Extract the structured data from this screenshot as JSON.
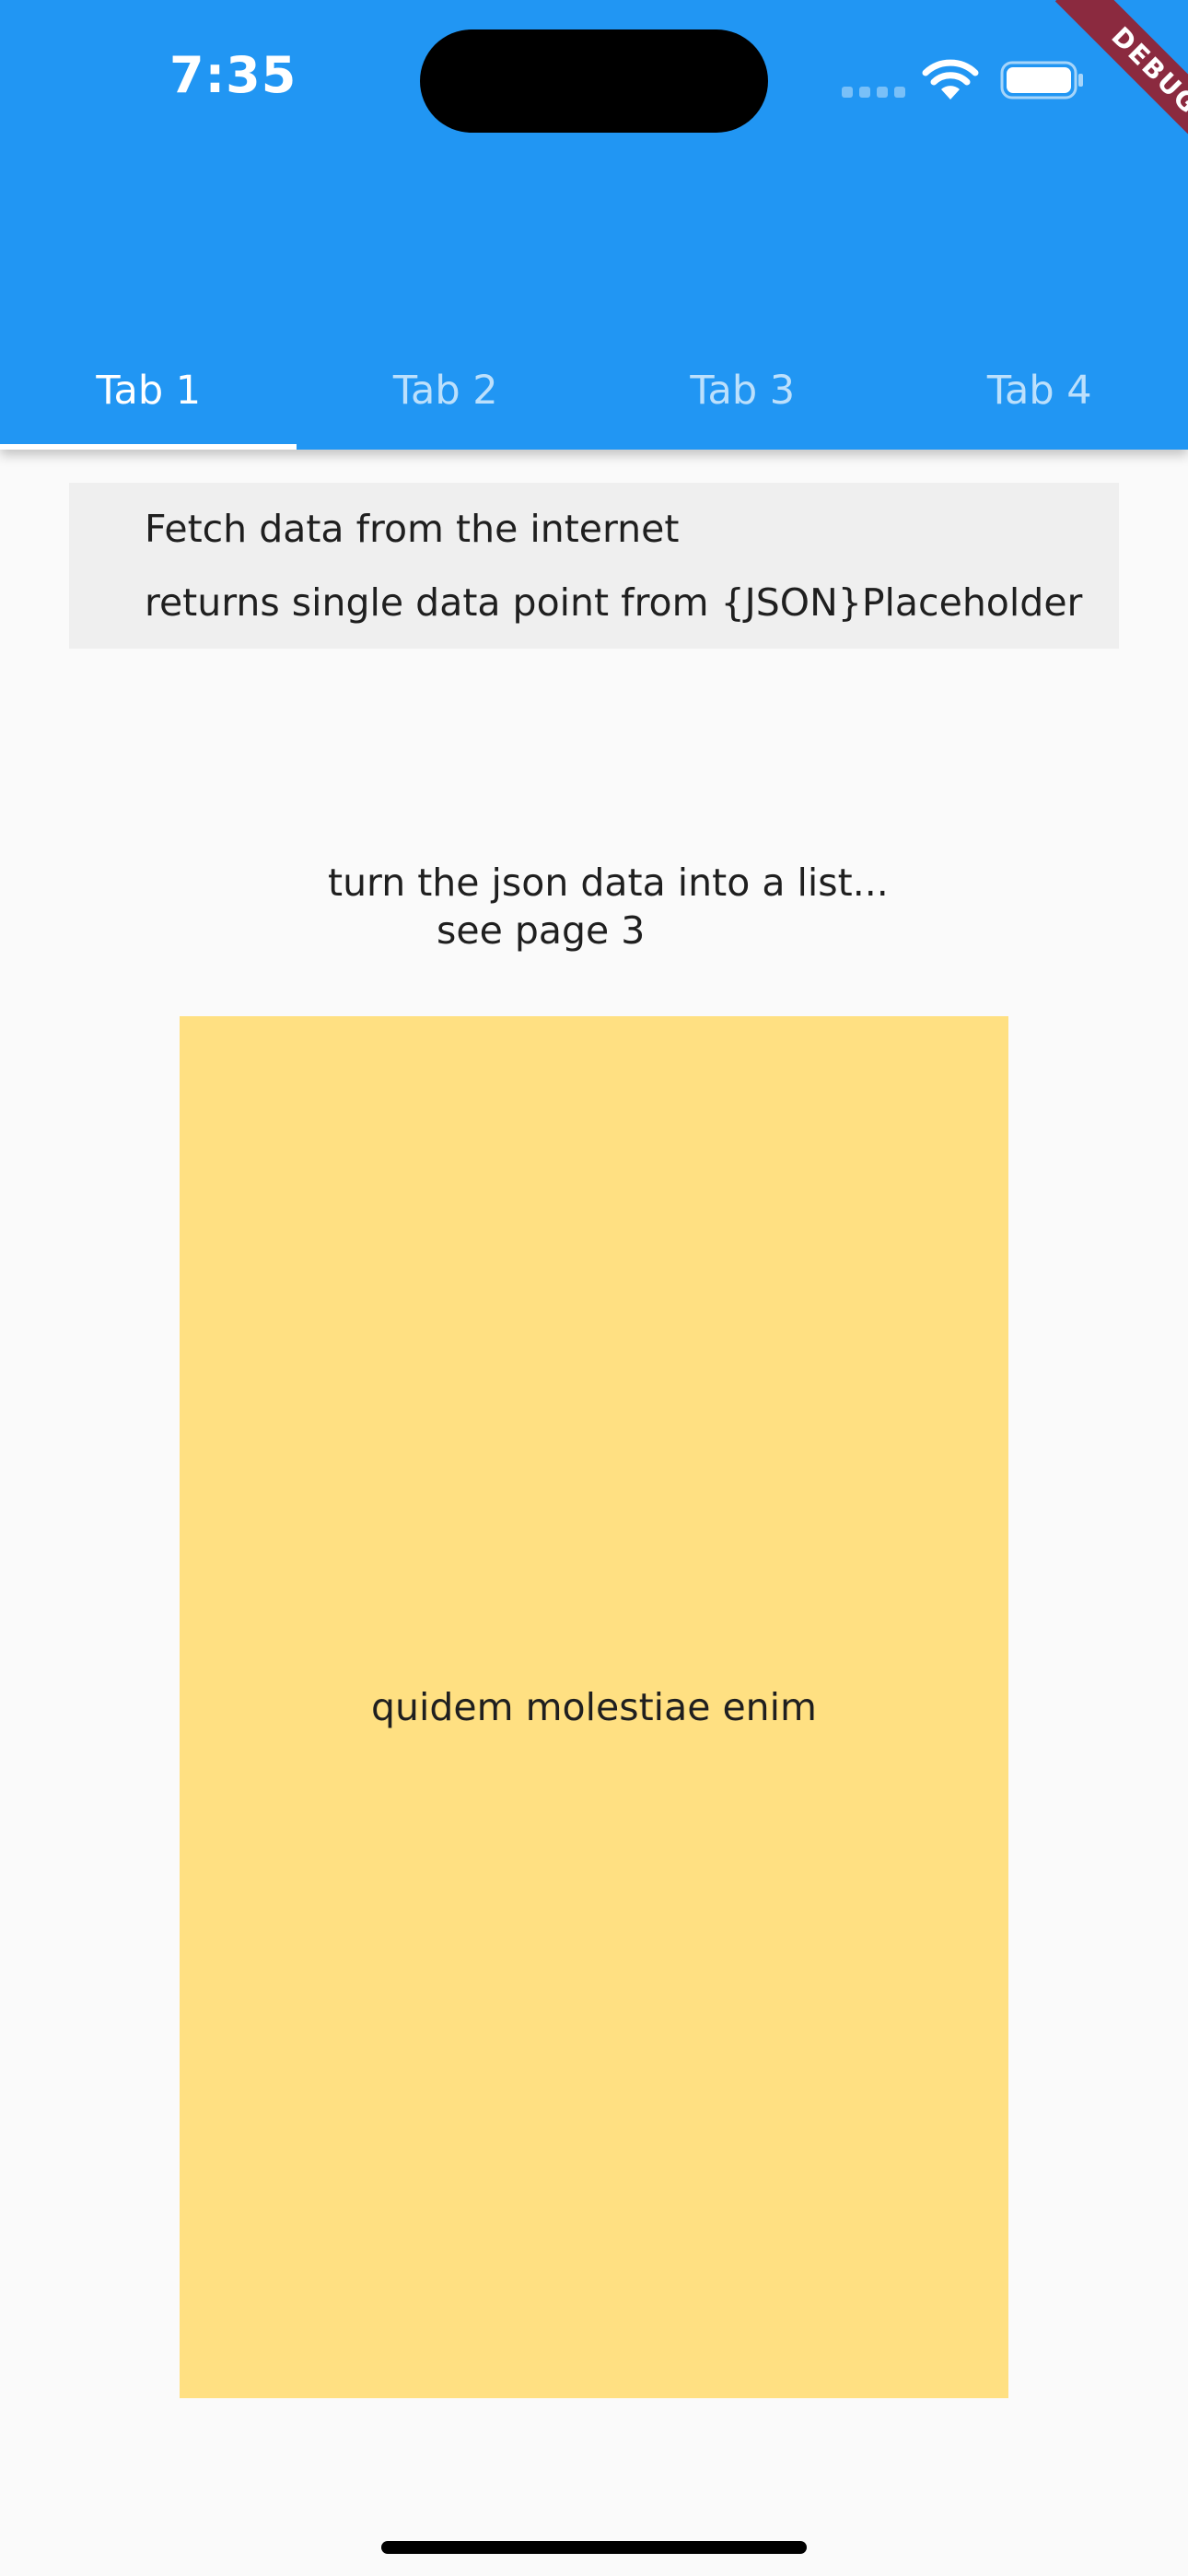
{
  "status_bar": {
    "time": "7:35",
    "signal_icon": "cellular-signal-icon",
    "wifi_icon": "wifi-icon",
    "battery_icon": "battery-icon"
  },
  "debug_banner": {
    "label": "DEBUG",
    "color": "#8b2a3f"
  },
  "app_bar": {
    "background_color": "#2196f3",
    "tabs": [
      {
        "label": "Tab 1",
        "selected": true
      },
      {
        "label": "Tab 2",
        "selected": false
      },
      {
        "label": "Tab 3",
        "selected": false
      },
      {
        "label": "Tab 4",
        "selected": false
      }
    ]
  },
  "info_box": {
    "title": "Fetch data from the internet",
    "subtitle": "returns single data point from {JSON}Placeholder"
  },
  "note": {
    "line1": "turn the json data into a list...",
    "line2": "see page 3"
  },
  "data_card": {
    "text": "quidem molestiae enim",
    "background_color": "#ffe082"
  }
}
